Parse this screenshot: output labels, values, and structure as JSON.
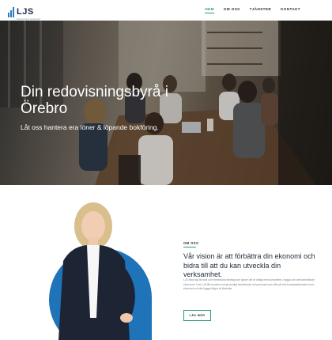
{
  "brand": {
    "name": "LJS",
    "tagline": "Redovisning & Lönekonsult"
  },
  "nav": {
    "items": [
      {
        "label": "HEM",
        "active": true
      },
      {
        "label": "OM OSS",
        "active": false
      },
      {
        "label": "TJÄNSTER",
        "active": false
      },
      {
        "label": "KONTAKT",
        "active": false
      }
    ]
  },
  "hero": {
    "title": "Din redovisningsbyrå i Örebro",
    "subtitle": "Låt oss hantera era löner & löpande bokföring."
  },
  "about": {
    "kicker": "OM OSS",
    "title": "Vår vision är att förbättra din ekonomi och bidra till att du kan utveckla din verksamhet.",
    "body": "LJS riktar sig till små och medelstora företag som tycker det är viktigt med kompetens, trygga och serviceinriktade ekonomer. Hos LJS får kunderna ett personligt bemötande och personal som står på hela kunskapsbredden inom ekonomi och där bygga frågor är förstudie.",
    "button_label": "LÄS MER"
  },
  "colors": {
    "accent": "#2a9a78",
    "brand_blue": "#1f73b9",
    "text_dark": "#1f2b3a"
  }
}
